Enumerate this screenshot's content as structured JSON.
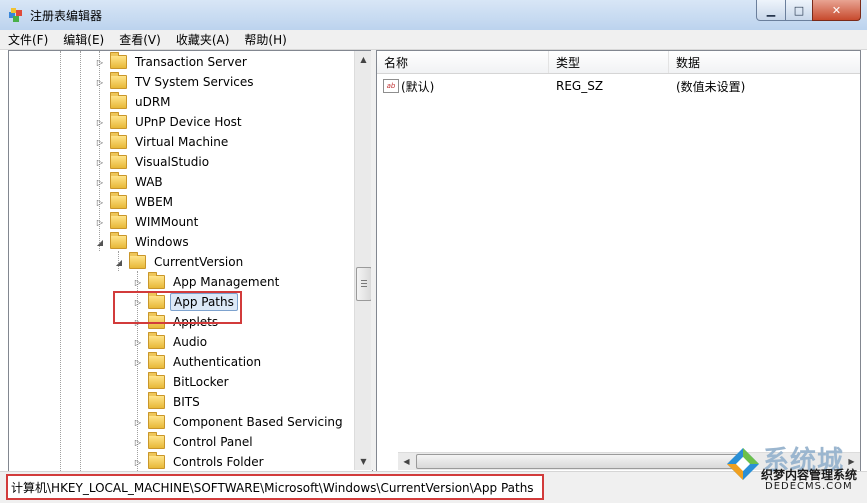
{
  "window": {
    "title": "注册表编辑器"
  },
  "menu": [
    {
      "label": "文件(F)"
    },
    {
      "label": "编辑(E)"
    },
    {
      "label": "查看(V)"
    },
    {
      "label": "收藏夹(A)"
    },
    {
      "label": "帮助(H)"
    }
  ],
  "tree": {
    "nodes": [
      {
        "label": "Transaction Server",
        "expander": "▷"
      },
      {
        "label": "TV System Services",
        "expander": "▷"
      },
      {
        "label": "uDRM",
        "expander": ""
      },
      {
        "label": "UPnP Device Host",
        "expander": "▷"
      },
      {
        "label": "Virtual Machine",
        "expander": "▷"
      },
      {
        "label": "VisualStudio",
        "expander": "▷"
      },
      {
        "label": "WAB",
        "expander": "▷"
      },
      {
        "label": "WBEM",
        "expander": "▷"
      },
      {
        "label": "WIMMount",
        "expander": "▷"
      },
      {
        "label": "Windows",
        "expander": "◢"
      },
      {
        "label": "CurrentVersion",
        "expander": "◢"
      },
      {
        "label": "App Management",
        "expander": "▷"
      },
      {
        "label": "App Paths",
        "expander": "▷",
        "selected": true
      },
      {
        "label": "Applets",
        "expander": "▷"
      },
      {
        "label": "Audio",
        "expander": "▷"
      },
      {
        "label": "Authentication",
        "expander": "▷"
      },
      {
        "label": "BitLocker",
        "expander": ""
      },
      {
        "label": "BITS",
        "expander": ""
      },
      {
        "label": "Component Based Servicing",
        "expander": "▷"
      },
      {
        "label": "Control Panel",
        "expander": "▷"
      },
      {
        "label": "Controls Folder",
        "expander": "▷"
      }
    ]
  },
  "list": {
    "columns": [
      "名称",
      "类型",
      "数据"
    ],
    "rows": [
      {
        "name": "(默认)",
        "type": "REG_SZ",
        "data": "(数值未设置)",
        "icon": "string-value-icon"
      }
    ]
  },
  "status": {
    "path": "计算机\\HKEY_LOCAL_MACHINE\\SOFTWARE\\Microsoft\\Windows\\CurrentVersion\\App Paths"
  },
  "watermark": {
    "big": "系统城",
    "line1": "织梦内容管理系统",
    "line2": "DEDECMS.COM"
  },
  "icons": {
    "string_value": "ab"
  },
  "colors": {
    "highlight": "#d23b3b",
    "selection": "#dce9f7"
  }
}
